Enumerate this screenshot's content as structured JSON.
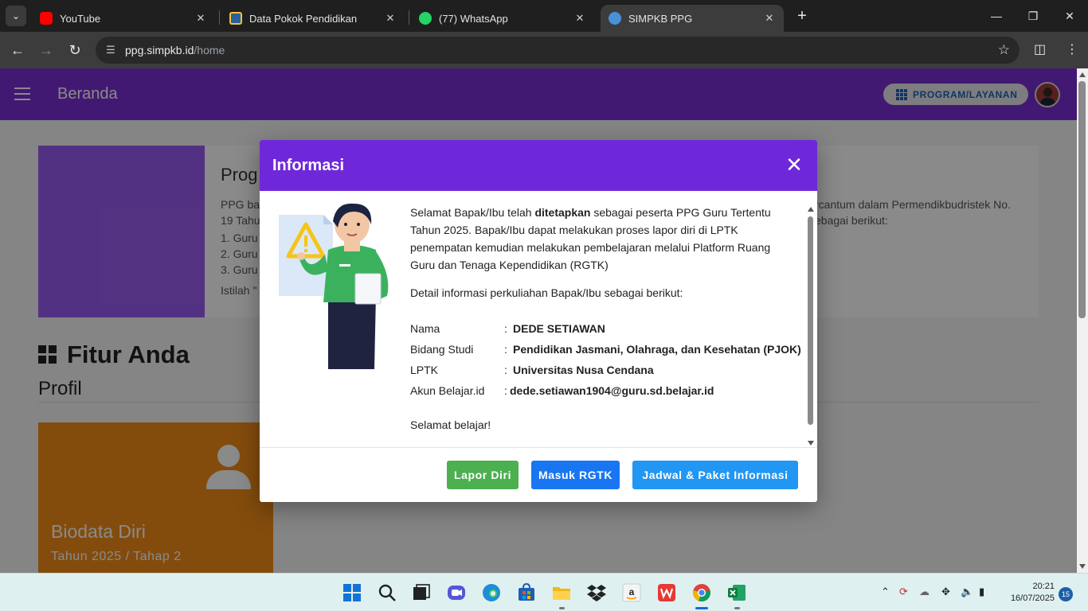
{
  "browser": {
    "tabs": [
      {
        "title": "YouTube"
      },
      {
        "title": "Data Pokok Pendidikan"
      },
      {
        "title": "(77) WhatsApp"
      },
      {
        "title": "SIMPKB PPG"
      }
    ],
    "url_host": "ppg.simpkb.id",
    "url_path": "/home"
  },
  "appbar": {
    "title": "Beranda",
    "program_button": "PROGRAM/LAYANAN"
  },
  "banner": {
    "title": "Prog",
    "text_left": "PPG ba",
    "text_left2": "19 Tahu",
    "text_right": "rcantum dalam Permendikbudristek No.",
    "text_right2": "ebagai berikut:",
    "list": [
      "1. Guru",
      "2. Guru",
      "3. Guru"
    ],
    "footer": "Istilah \""
  },
  "features": {
    "heading": "Fitur Anda",
    "section": "Profil",
    "card_title": "Biodata Diri",
    "card_subtitle": "Tahun 2025 / Tahap 2"
  },
  "modal": {
    "title": "Informasi",
    "intro_pre": "Selamat Bapak/Ibu telah ",
    "intro_bold": "ditetapkan",
    "intro_post": " sebagai peserta PPG Guru Tertentu Tahun 2025. Bapak/Ibu dapat melakukan proses lapor diri di LPTK penempatan kemudian melakukan pembelajaran melalui Platform Ruang Guru dan Tenaga Kependidikan (RGTK)",
    "detail_heading": "Detail informasi perkuliahan Bapak/Ibu sebagai berikut:",
    "rows": [
      {
        "label": "Nama",
        "colon": ":",
        "value": "DEDE SETIAWAN"
      },
      {
        "label": "Bidang Studi",
        "colon": ":",
        "value": "Pendidikan Jasmani, Olahraga, dan Kesehatan (PJOK)"
      },
      {
        "label": "LPTK",
        "colon": ":",
        "value": "Universitas Nusa Cendana"
      },
      {
        "label": "Akun Belajar.id",
        "colon": ":",
        "value": "dede.setiawan1904@guru.sd.belajar.id"
      }
    ],
    "closing": "Selamat belajar!",
    "buttons": {
      "lapor": "Lapor Diri",
      "masuk": "Masuk RGTK",
      "jadwal": "Jadwal & Paket Informasi"
    }
  },
  "taskbar": {
    "time": "20:21",
    "date": "16/07/2025",
    "notifications": "15"
  },
  "colors": {
    "accent_purple": "#6f28d9",
    "green": "#4caf50",
    "blue": "#1976f2",
    "orange": "#f28c18"
  }
}
